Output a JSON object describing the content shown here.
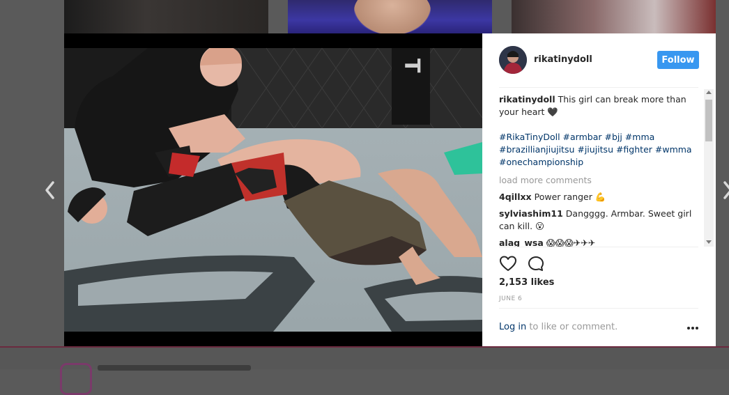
{
  "post": {
    "username": "rikatinydoll",
    "follow_label": "Follow",
    "caption_username": "rikatinydoll",
    "caption_text": "This girl can break more than your heart 🖤",
    "hashtags": "#RikaTinyDoll #armbar #bjj #mma #brazillianjiujitsu #jiujitsu #fighter #wmma #onechampionship",
    "load_more": "load more comments",
    "comments": [
      {
        "user": "4qillxx",
        "text": "Power ranger 💪"
      },
      {
        "user": "sylviashim11",
        "text": "Dangggg. Armbar. Sweet girl can kill. 😮"
      },
      {
        "user": "alag_wsa",
        "text": "😱😱😱✈✈✈"
      }
    ],
    "likes": "2,153 likes",
    "date": "JUNE 6",
    "login_link": "Log in",
    "login_suffix": " to like or comment."
  },
  "icons": {
    "like": "heart-icon",
    "comment": "comment-icon",
    "prev": "chevron-left-icon",
    "next": "chevron-right-icon",
    "more": "more-options-icon"
  },
  "colors": {
    "follow_button": "#3897f0",
    "hashtag": "#003569",
    "muted": "#999999",
    "overlay": "#5a5a5a"
  }
}
